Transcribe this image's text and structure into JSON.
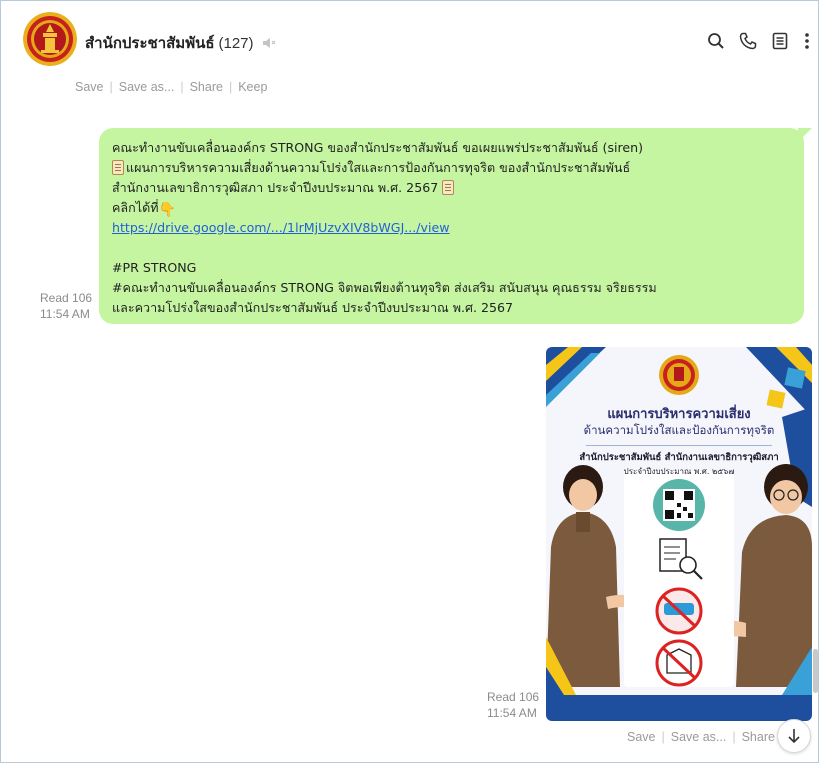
{
  "header": {
    "title": "สำนักประชาสัมพันธ์",
    "member_count": "(127)",
    "icons": [
      "search-icon",
      "phone-icon",
      "notes-icon",
      "more-icon"
    ]
  },
  "actions_top": {
    "save": "Save",
    "save_as": "Save as...",
    "share": "Share",
    "keep": "Keep"
  },
  "message_text": {
    "lines": [
      "คณะทำงานขับเคลื่อนองค์กร STRONG ของสำนักประชาสัมพันธ์ ขอเผยแพร่ประชาสัมพันธ์ (siren)",
      "แผนการบริหารความเสี่ยงด้านความโปร่งใสและการป้องกันการทุจริต ของสำนักประชาสัมพันธ์",
      "สำนักงานเลขาธิการวุฒิสภา ประจำปีงบประมาณ พ.ศ. 2567",
      "คลิกได้ที่",
      "https://drive.google.com/.../1lrMjUzvXIV8bWGJ.../view",
      "#PR STRONG",
      "#คณะทำงานขับเคลื่อนองค์กร STRONG จิตพอเพียงต้านทุจริต ส่งเสริม สนับสนุน คุณธรรม จริยธรรม",
      "และความโปร่งใสของสำนักประชาสัมพันธ์ ประจำปีงบประมาณ พ.ศ. 2567"
    ],
    "read": "Read 106",
    "time": "11:54 AM"
  },
  "message_image": {
    "poster_title_1": "แผนการบริหารความเสี่ยง",
    "poster_title_2": "ด้านความโปร่งใสและป้องกันการทุจริต",
    "poster_org": "สำนักประชาสัมพันธ์ สำนักงานเลขาธิการวุฒิสภา",
    "poster_year": "ประจำปีงบประมาณ พ.ศ. ๒๕๖๗",
    "read": "Read 106",
    "time": "11:54 AM"
  },
  "actions_bottom": {
    "save": "Save",
    "save_as": "Save as...",
    "share": "Share"
  },
  "colors": {
    "bubble": "#c5f5a1",
    "link": "#2360d6",
    "poster_blue": "#1e4f9e",
    "poster_yellow": "#f5c518"
  }
}
